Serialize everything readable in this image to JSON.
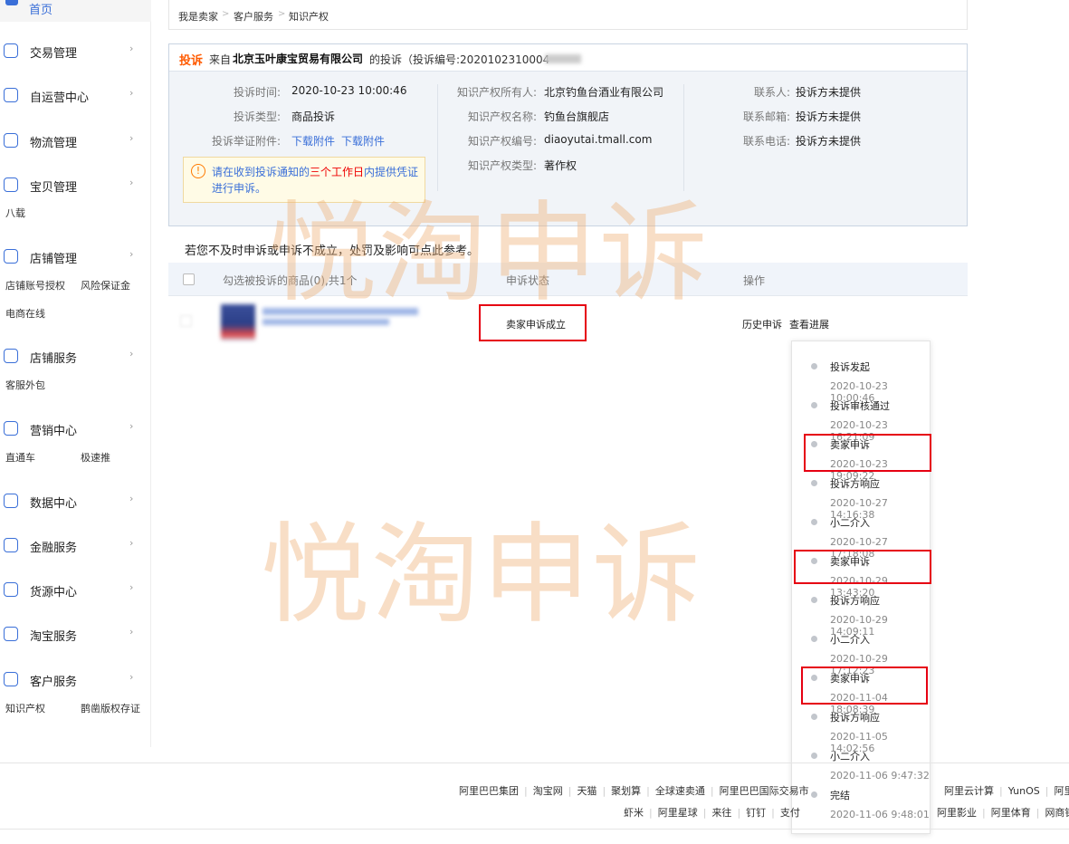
{
  "sidebar": {
    "top": "首页",
    "items": [
      {
        "label": "交易管理"
      },
      {
        "label": "自运营中心"
      },
      {
        "label": "物流管理"
      },
      {
        "label": "宝贝管理"
      },
      {
        "label": "店铺管理"
      },
      {
        "label": "店铺服务"
      },
      {
        "label": "营销中心"
      },
      {
        "label": "数据中心"
      },
      {
        "label": "金融服务"
      },
      {
        "label": "货源中心"
      },
      {
        "label": "淘宝服务"
      },
      {
        "label": "客户服务"
      }
    ],
    "subs": {
      "baozhuang": "八载",
      "shop_auth": "店铺账号授权",
      "risk_deposit": "风险保证金",
      "ec_online": "电商在线",
      "cs_outsource": "客服外包",
      "ztc": "直通车",
      "jisu": "极速推",
      "ip": "知识产权",
      "copyright": "鹊凿版权存证"
    }
  },
  "breadcrumb": [
    "我是卖家",
    "客户服务",
    "知识产权"
  ],
  "complaint": {
    "tag": "投诉",
    "from_prefix": "来自",
    "company": "北京玉叶康宝贸易有限公司",
    "suffix": "的投诉（投诉编号:2020102310004",
    "fields_left": [
      {
        "k": "投诉时间:",
        "v": "2020-10-23 10:00:46"
      },
      {
        "k": "投诉类型:",
        "v": "商品投诉"
      },
      {
        "k": "投诉举证附件:",
        "v1": "下载附件",
        "v2": "下载附件"
      }
    ],
    "fields_mid": [
      {
        "k": "知识产权所有人:",
        "v": "北京钓鱼台酒业有限公司"
      },
      {
        "k": "知识产权名称:",
        "v": "钓鱼台旗舰店"
      },
      {
        "k": "知识产权编号:",
        "v": "diaoyutai.tmall.com"
      },
      {
        "k": "知识产权类型:",
        "v": "著作权"
      }
    ],
    "fields_right": [
      {
        "k": "联系人:",
        "v": "投诉方未提供"
      },
      {
        "k": "联系邮箱:",
        "v": "投诉方未提供"
      },
      {
        "k": "联系电话:",
        "v": "投诉方未提供"
      }
    ],
    "warning": {
      "pre": "请在收到投诉通知的",
      "red": "三个工作日",
      "post": "内提供凭证进行申诉。"
    }
  },
  "note": "若您不及时申诉或申诉不成立，处罚及影响可点此参考。",
  "table": {
    "headers": {
      "goods": "勾选被投诉的商品(0),共1个",
      "status": "申诉状态",
      "ops": "操作"
    },
    "row": {
      "status": "卖家申诉成立",
      "op1": "历史申诉",
      "op2": "查看进展"
    }
  },
  "timeline": [
    {
      "name": "投诉发起",
      "time": "2020-10-23 10:00:46"
    },
    {
      "name": "投诉审核通过",
      "time": "2020-10-23 16:21:09"
    },
    {
      "name": "卖家申诉",
      "time": "2020-10-23 19:09:22"
    },
    {
      "name": "投诉方响应",
      "time": "2020-10-27 14:16:38"
    },
    {
      "name": "小二介入",
      "time": "2020-10-27 17:18:08"
    },
    {
      "name": "卖家申诉",
      "time": "2020-10-29 13:43:20"
    },
    {
      "name": "投诉方响应",
      "time": "2020-10-29 14:09:11"
    },
    {
      "name": "小二介入",
      "time": "2020-10-29 17:12:23"
    },
    {
      "name": "卖家申诉",
      "time": "2020-11-04 18:08:39"
    },
    {
      "name": "投诉方响应",
      "time": "2020-11-05 14:02:56"
    },
    {
      "name": "小二介入",
      "time": "2020-11-06 9:47:32"
    },
    {
      "name": "完结",
      "time": "2020-11-06 9:48:01"
    }
  ],
  "watermark": "悦淘申诉",
  "footer": {
    "row1": [
      "阿里巴巴集团",
      "淘宝网",
      "天猫",
      "聚划算",
      "全球速卖通",
      "阿里巴巴国际交易市"
    ],
    "row1_right": [
      "阿里云计算",
      "YunOS",
      "阿里"
    ],
    "row2": [
      "虾米",
      "阿里星球",
      "来往",
      "钉钉",
      "支付"
    ],
    "row2_right": [
      "阿里影业",
      "阿里体育",
      "网商银"
    ]
  },
  "colors": {
    "accent": "#3a6fd8",
    "tag": "#ff5a00",
    "highlight": "#e60012",
    "watermark": "#eeb078"
  }
}
